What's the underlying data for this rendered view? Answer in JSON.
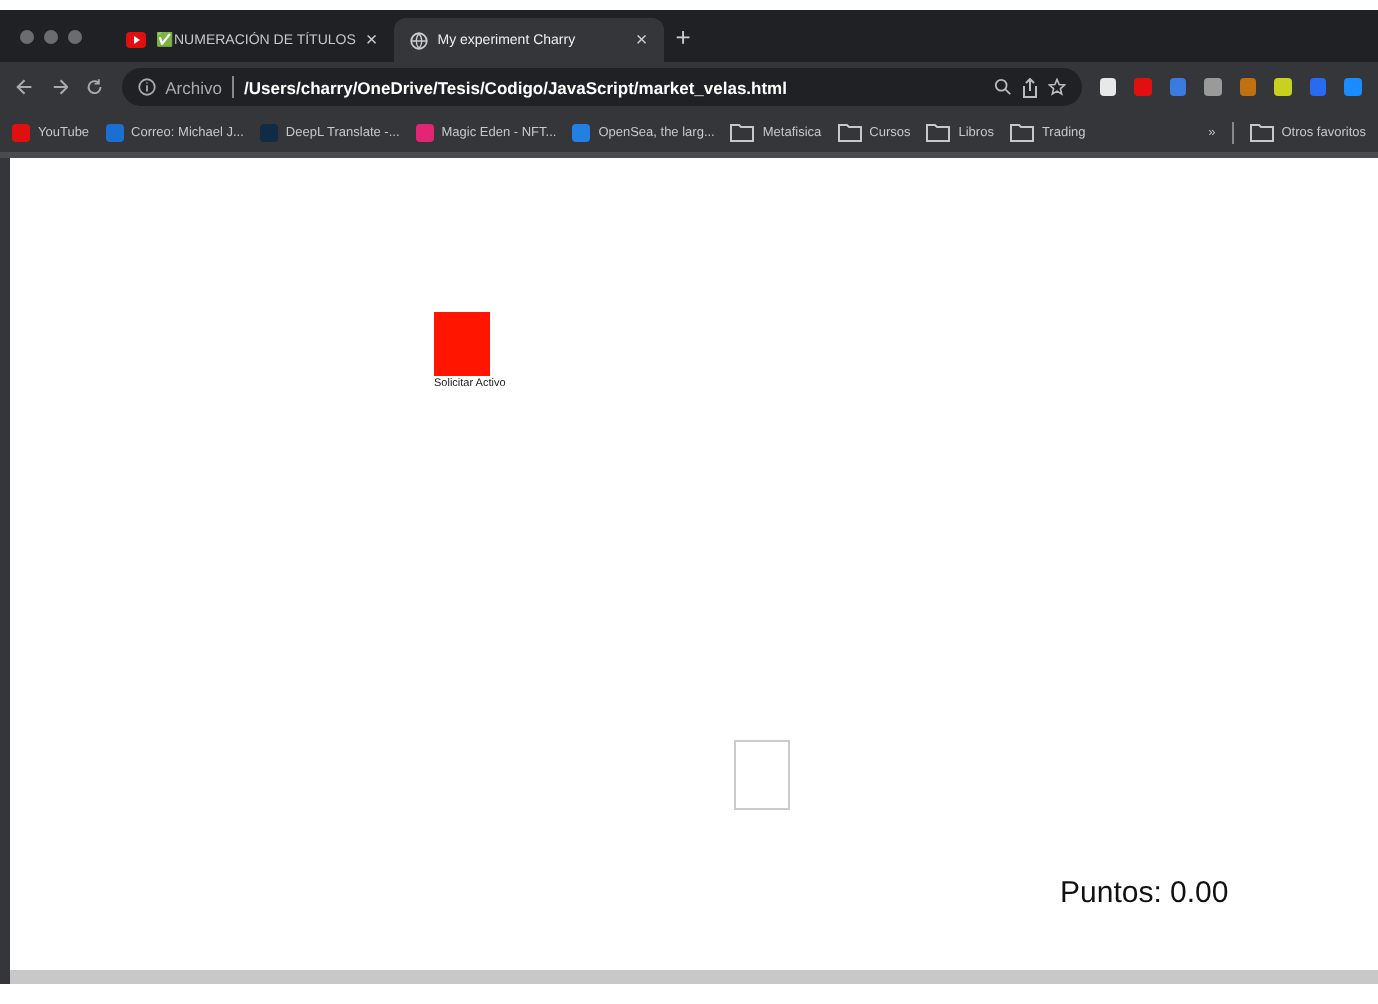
{
  "tabs": [
    {
      "title": "✅NUMERACIÓN DE TÍTULOS",
      "close": "×",
      "selected": false
    },
    {
      "title": "My experiment Charry",
      "close": "×",
      "selected": true
    }
  ],
  "new_tab": "+",
  "address_bar": {
    "scheme_label": "Archivo",
    "url": "/Users/charry/OneDrive/Tesis/Codigo/JavaScript/market_velas.html"
  },
  "extensions": [
    {
      "color": "#e8e8e8"
    },
    {
      "color": "#e01010"
    },
    {
      "color": "#3b7be0"
    },
    {
      "color": "#9a9a9a"
    },
    {
      "color": "#c07010"
    },
    {
      "color": "#c8d020"
    },
    {
      "color": "#2a6af0"
    },
    {
      "color": "#1a8cff"
    }
  ],
  "bookmarks": [
    {
      "label": "YouTube",
      "color": "#e01010"
    },
    {
      "label": "Correo: Michael J...",
      "color": "#1a6fd0"
    },
    {
      "label": "DeepL Translate -...",
      "color": "#0f2b46"
    },
    {
      "label": "Magic Eden - NFT...",
      "color": "#e42575"
    },
    {
      "label": "OpenSea, the larg...",
      "color": "#2081e2"
    }
  ],
  "bookmark_folders": [
    "Metafisica",
    "Cursos",
    "Libros",
    "Trading"
  ],
  "overflow": "»",
  "other_bookmarks": "Otros favoritos",
  "page": {
    "button_label": "Solicitar Activo",
    "score": "Puntos: 0.00"
  }
}
